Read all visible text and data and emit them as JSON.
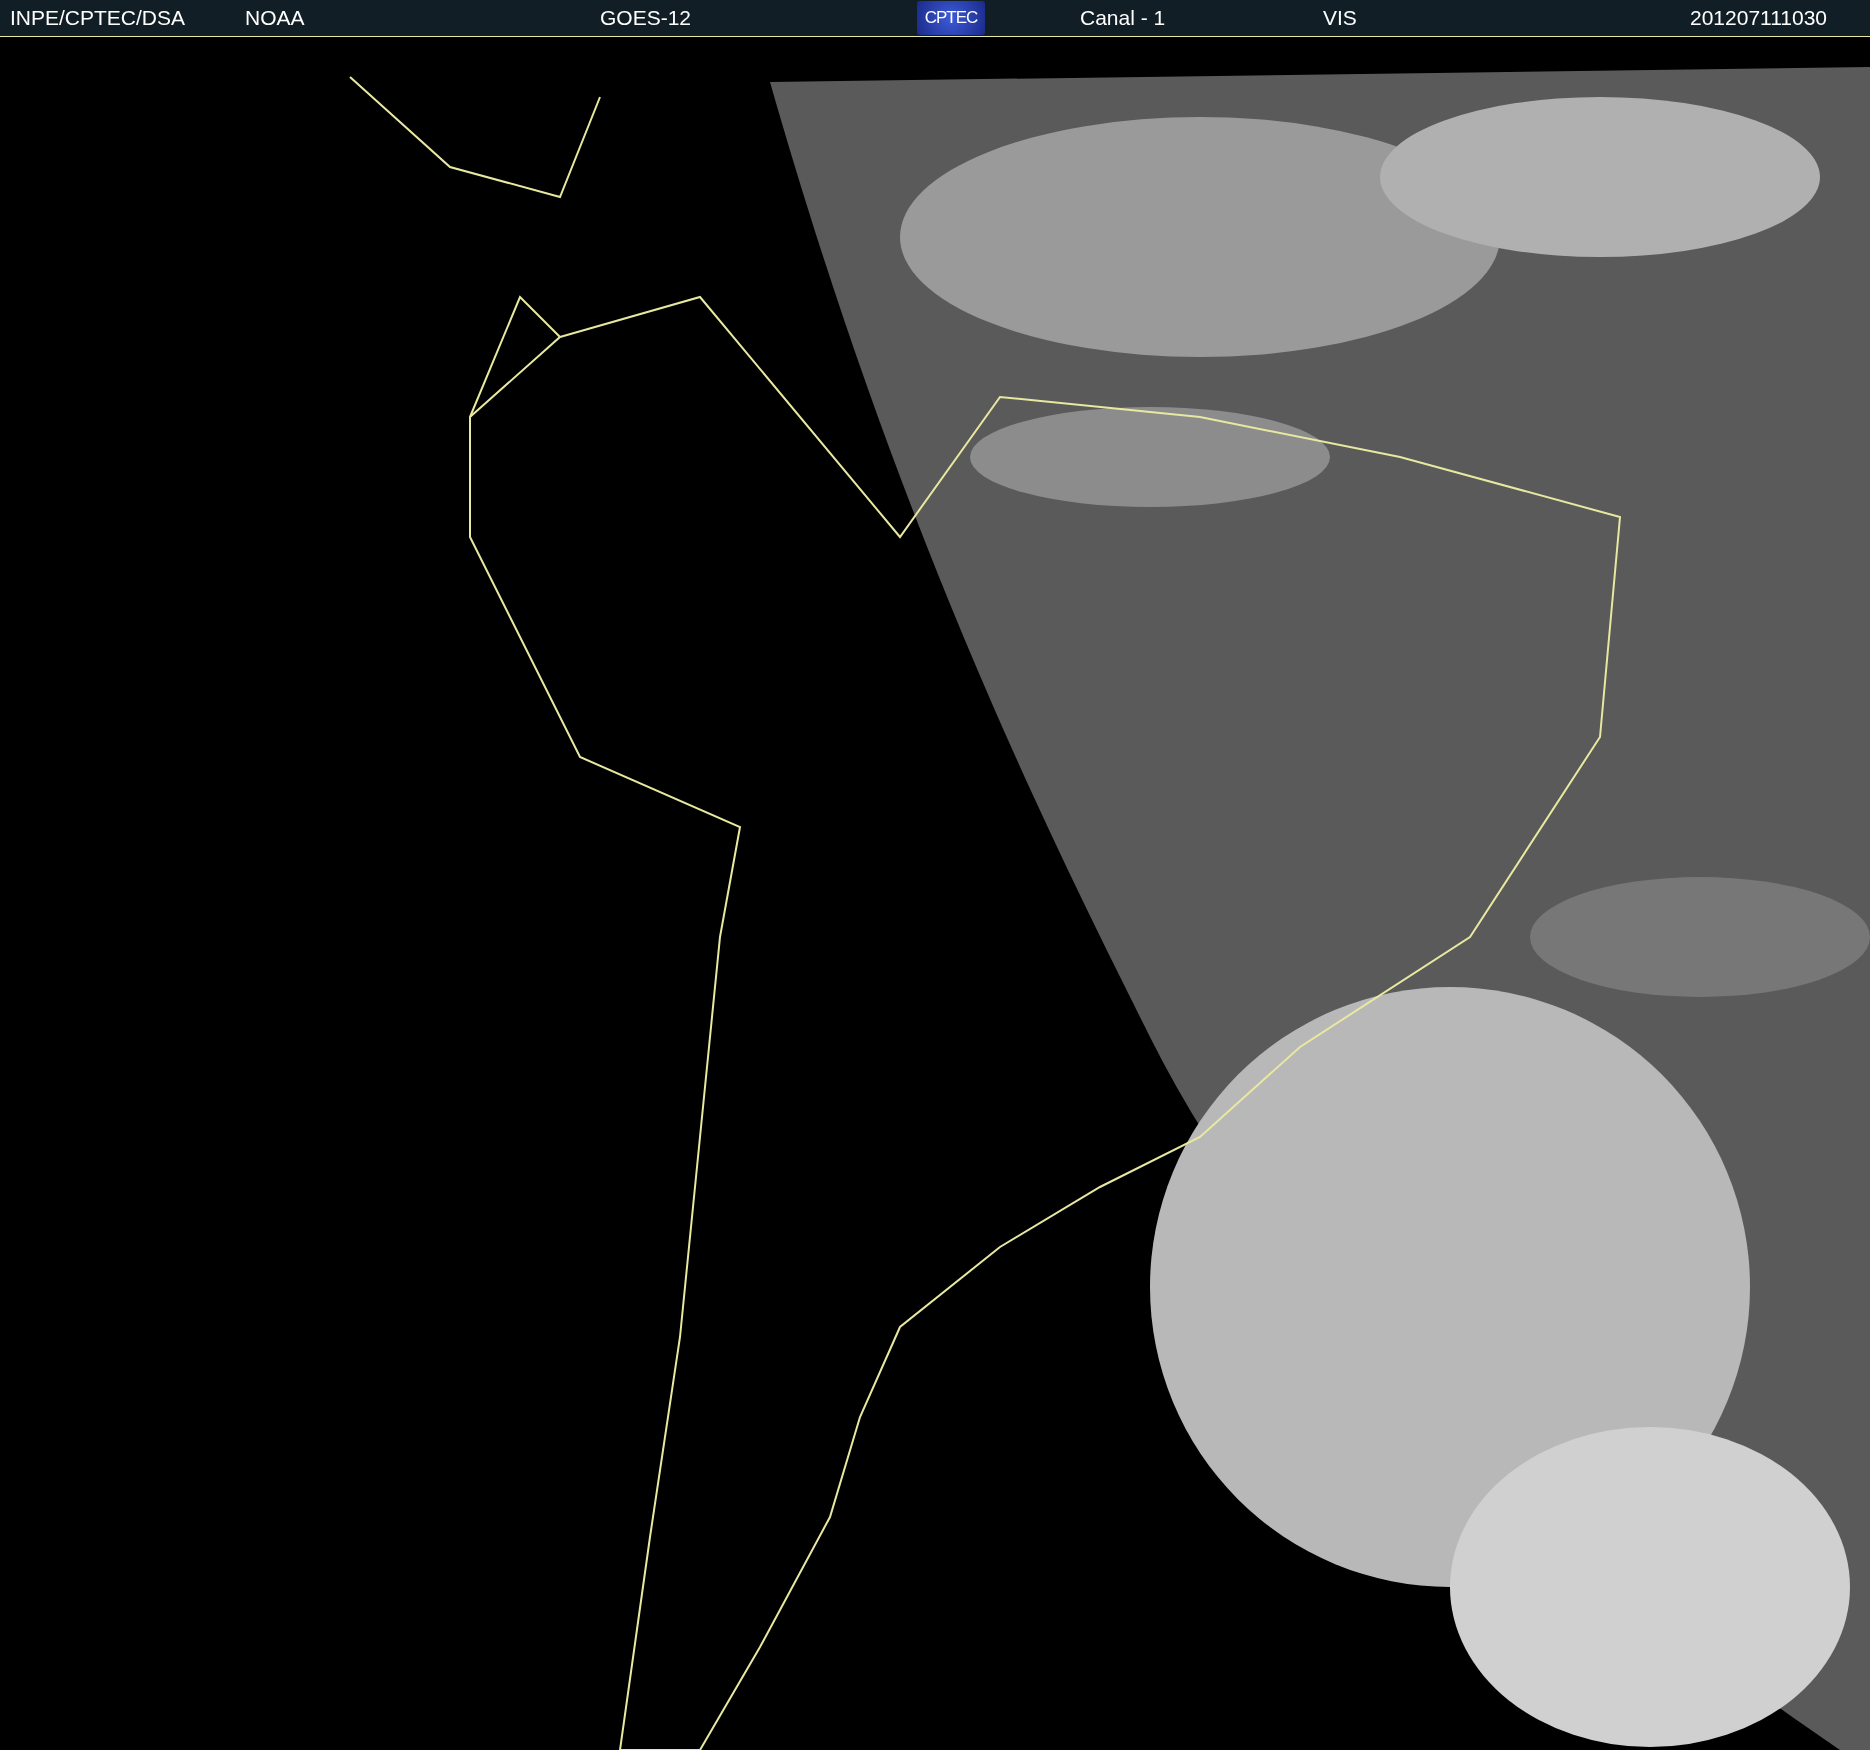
{
  "header": {
    "items": [
      {
        "kind": "text",
        "text": "INPE/CPTEC/DSA"
      },
      {
        "kind": "text",
        "text": "NOAA"
      },
      {
        "kind": "text",
        "text": "GOES-12"
      },
      {
        "kind": "logo",
        "text": "CPTEC"
      },
      {
        "kind": "text",
        "text": "Canal - 1"
      },
      {
        "kind": "text",
        "text": "VIS"
      },
      {
        "kind": "text",
        "text": "201207111030"
      }
    ]
  }
}
